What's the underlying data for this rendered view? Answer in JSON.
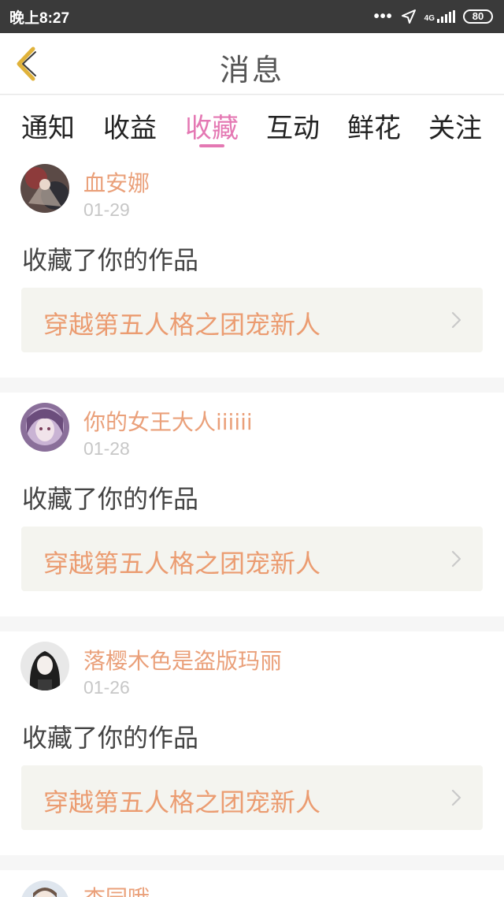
{
  "status": {
    "time": "晚上8:27",
    "dots": "•••",
    "network": "4G",
    "battery": "80"
  },
  "header": {
    "title": "消息"
  },
  "tabs": [
    {
      "label": "通知"
    },
    {
      "label": "收益"
    },
    {
      "label": "收藏",
      "active": true
    },
    {
      "label": "互动"
    },
    {
      "label": "鲜花"
    },
    {
      "label": "关注"
    }
  ],
  "messages": [
    {
      "user": "血安娜",
      "date": "01-29",
      "action": "收藏了你的作品",
      "work": "穿越第五人格之团宠新人"
    },
    {
      "user": "你的女王大人iiiiii",
      "date": "01-28",
      "action": "收藏了你的作品",
      "work": "穿越第五人格之团宠新人"
    },
    {
      "user": "落樱木色是盗版玛丽",
      "date": "01-26",
      "action": "收藏了你的作品",
      "work": "穿越第五人格之团宠新人"
    },
    {
      "user": "杢园哦",
      "date": "",
      "action": "",
      "work": ""
    }
  ],
  "colors": {
    "accent": "#e478b3",
    "username": "#eaa07a",
    "work_title": "#eb9c71",
    "back_icon": "#e0b23a"
  }
}
